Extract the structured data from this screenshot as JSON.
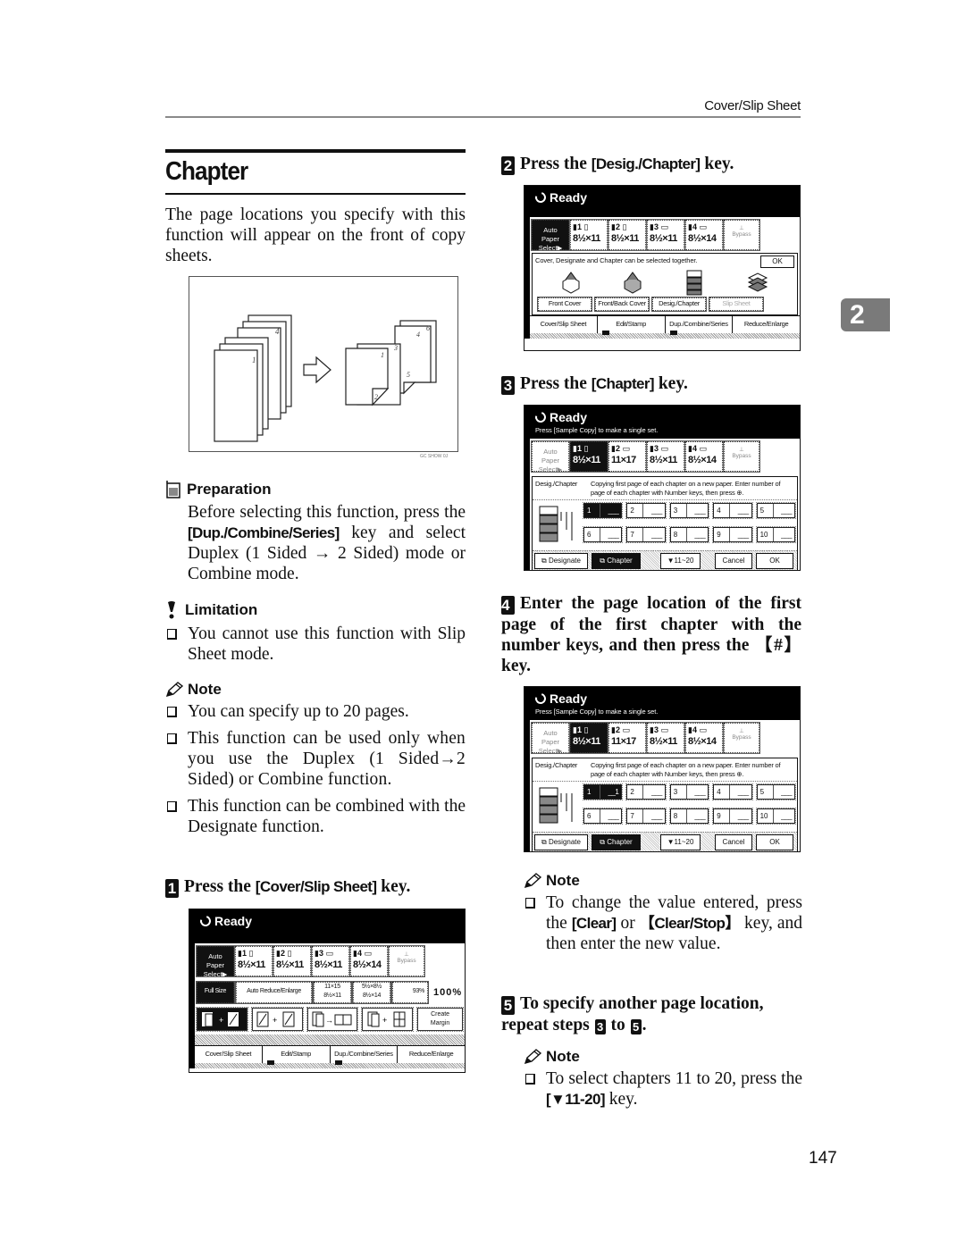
{
  "header": {
    "running_title": "Cover/Slip Sheet",
    "chapter_tab": "2"
  },
  "page_number": "147",
  "section": {
    "title": "Chapter",
    "intro": "The page locations you specify with this function will appear on the front of copy sheets.",
    "illustration": {
      "caption": "GC SHOW 0J",
      "source_pages": [
        "1",
        "4"
      ],
      "result_pages": [
        "1",
        "2",
        "3",
        "4",
        "5",
        "6"
      ]
    },
    "preparation": {
      "heading": "Preparation",
      "text_before": "Before selecting this function, press the ",
      "key": "[Dup./Combine/Series]",
      "text_after": " key and select Duplex (1 Sided → 2 Sided) mode or Combine mode."
    },
    "limitation": {
      "heading": "Limitation",
      "items": [
        "You cannot use this function with Slip Sheet mode."
      ]
    },
    "note": {
      "heading": "Note",
      "items": [
        "You can specify up to 20 pages.",
        "This function can be used only when you use the Duplex (1 Sided→2 Sided) or Combine function.",
        "This function can be combined with the Designate function."
      ]
    }
  },
  "steps": [
    {
      "number": "1",
      "text_before": "Press the ",
      "key": "[Cover/Slip Sheet]",
      "text_after": " key."
    },
    {
      "number": "2",
      "text_before": "Press the ",
      "key": "[Desig./Chapter]",
      "text_after": " key."
    },
    {
      "number": "3",
      "text_before": "Press the ",
      "key": "[Chapter]",
      "text_after": " key."
    },
    {
      "number": "4",
      "text": "Enter the page location of the first page of the first chapter with the number keys, and then press the 【#】 key."
    },
    {
      "number": "5",
      "text_before": "To specify another page location, repeat steps ",
      "ref_from": "3",
      "ref_mid": " to ",
      "ref_to": "5",
      "text_after": "."
    }
  ],
  "step4_note": {
    "heading": "Note",
    "text_before": "To change the value entered, press the ",
    "key1": "[Clear]",
    "mid": " or ",
    "key2": "【Clear/Stop】",
    "text_after": " key, and then enter the new value."
  },
  "step5_note": {
    "heading": "Note",
    "text_before": "To select chapters 11 to 20, press the ",
    "key": "[▼11-20]",
    "text_after": " key."
  },
  "screens": {
    "status": "Ready",
    "sample_msg": "Press [Sample Copy] to make a single set.",
    "auto_paper": [
      "Auto Paper",
      "Select▶"
    ],
    "trays_main": [
      {
        "label": "1",
        "size": "8½×11"
      },
      {
        "label": "2",
        "size": "8½×11"
      },
      {
        "label": "3",
        "size": "8½×11"
      },
      {
        "label": "4",
        "size": "8½×14"
      }
    ],
    "trays_chapter": [
      {
        "label": "1",
        "size": "8½×11"
      },
      {
        "label": "2",
        "size": "11×17"
      },
      {
        "label": "3",
        "size": "8½×11"
      },
      {
        "label": "4",
        "size": "8½×14"
      }
    ],
    "bypass": "Bypass",
    "tabs": [
      "Cover/Slip Sheet",
      "Edit/Stamp",
      "Dup./Combine/Series",
      "Reduce/Enlarge"
    ],
    "panel1": {
      "full_size": "Full Size",
      "auto_reduce": "Auto Reduce/Enlarge",
      "ratio1": [
        "11×15",
        "8½×11"
      ],
      "ratio2": [
        "5½×8½",
        "8½×14"
      ],
      "ratio3": "93%",
      "current_ratio": "100%",
      "create_margin": [
        "Create",
        "Margin"
      ]
    },
    "panel2": {
      "message": "Cover, Designate and Chapter can be selected together.",
      "ok": "OK",
      "buttons": [
        "Front Cover",
        "Front/Back Cover",
        "Desig./Chapter",
        "Slip Sheet"
      ]
    },
    "chapter_panel": {
      "label": "Desig./Chapter",
      "message": "Copying first page of each chapter on a new paper. Enter number of page of each chapter with Number keys, then press ⊕.",
      "cells_panel3": [
        {
          "n": "1",
          "v": "___"
        },
        {
          "n": "2",
          "v": "___"
        },
        {
          "n": "3",
          "v": "___"
        },
        {
          "n": "4",
          "v": "___"
        },
        {
          "n": "5",
          "v": "___"
        },
        {
          "n": "6",
          "v": "___"
        },
        {
          "n": "7",
          "v": "___"
        },
        {
          "n": "8",
          "v": "___"
        },
        {
          "n": "9",
          "v": "___"
        },
        {
          "n": "10",
          "v": "___"
        }
      ],
      "cells_panel4": [
        {
          "n": "1",
          "v": "__1"
        },
        {
          "n": "2",
          "v": "___"
        },
        {
          "n": "3",
          "v": "___"
        },
        {
          "n": "4",
          "v": "___"
        },
        {
          "n": "5",
          "v": "___"
        },
        {
          "n": "6",
          "v": "___"
        },
        {
          "n": "7",
          "v": "___"
        },
        {
          "n": "8",
          "v": "___"
        },
        {
          "n": "9",
          "v": "___"
        },
        {
          "n": "10",
          "v": "___"
        }
      ],
      "designate": "Designate",
      "chapter": "Chapter",
      "next_range": "▼11~20",
      "cancel": "Cancel",
      "ok": "OK"
    }
  }
}
